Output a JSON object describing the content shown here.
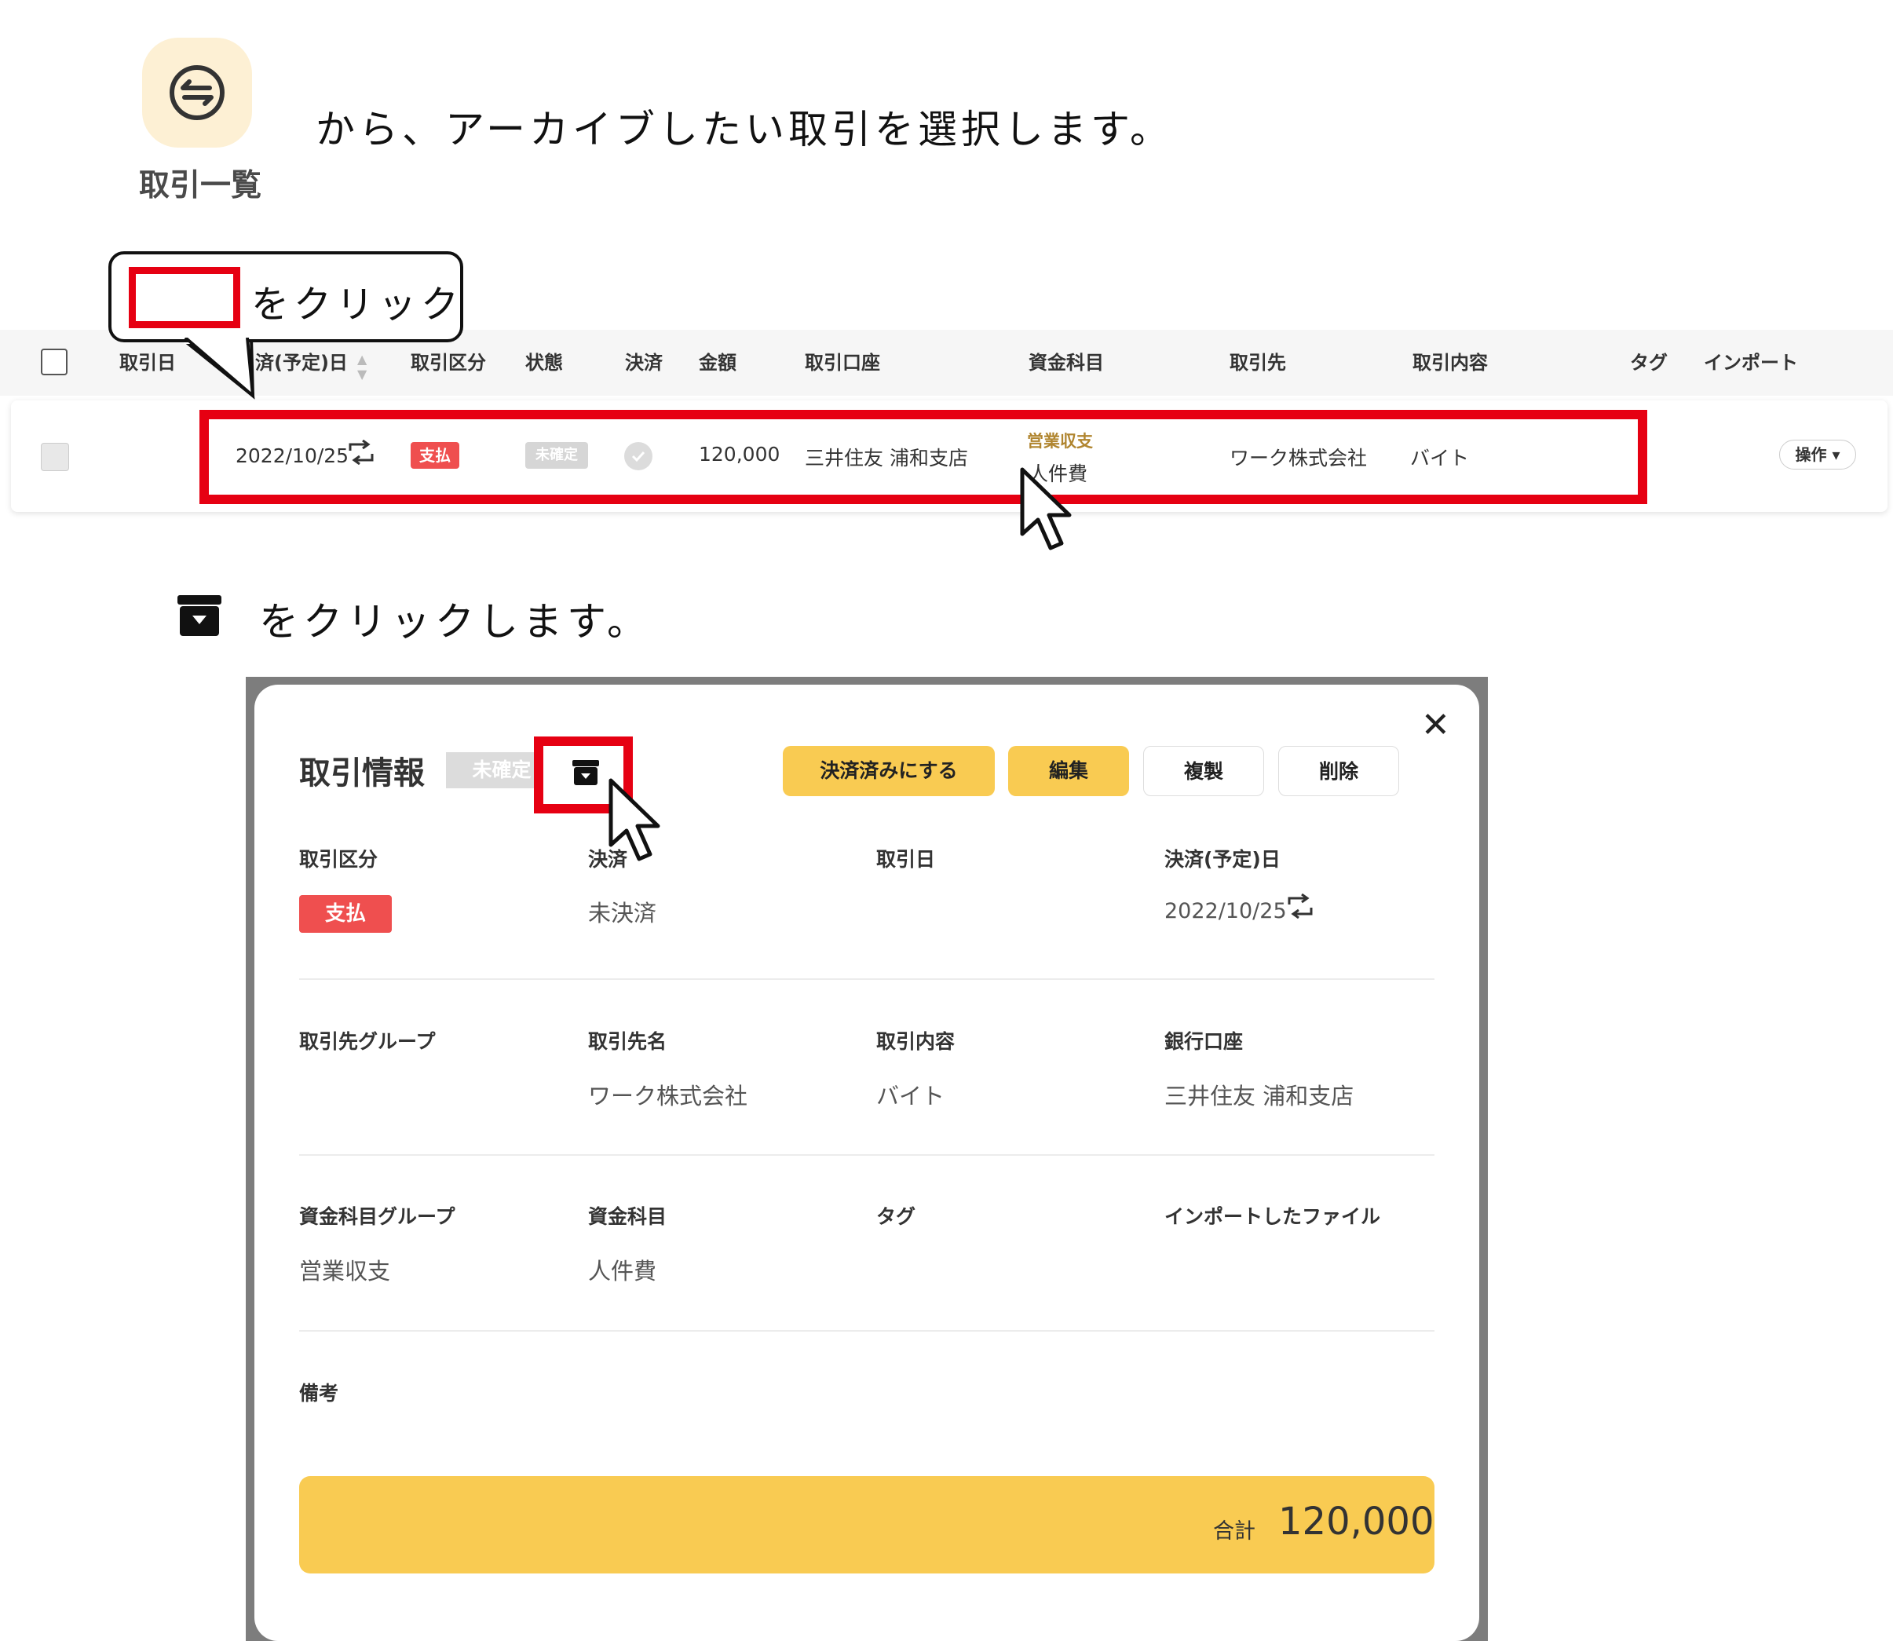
{
  "step1": {
    "nav_icon_name": "transactions-icon",
    "nav_label": "取引一覧",
    "text": "から、アーカイブしたい取引を選択します。"
  },
  "callout": {
    "text": "をクリック"
  },
  "table": {
    "headers": [
      "取引日",
      "済(予定)日",
      "取引区分",
      "状態",
      "決済",
      "金額",
      "取引口座",
      "資金科目",
      "取引先",
      "取引内容",
      "タグ",
      "インポート"
    ],
    "row": {
      "date": "2022/10/25",
      "type_badge": "支払",
      "status_badge": "未確定",
      "amount": "120,000",
      "account": "三井住友 浦和支店",
      "fund_group": "営業収支",
      "fund_item": "人件費",
      "partner": "ワーク株式会社",
      "content": "バイト",
      "ops_label": "操作 ▾"
    }
  },
  "step2": {
    "icon_name": "archive-icon",
    "text": "をクリックします。"
  },
  "modal": {
    "title": "取引情報",
    "status": "未確定",
    "buttons": {
      "settle": "決済済みにする",
      "edit": "編集",
      "duplicate": "複製",
      "delete": "削除"
    },
    "close": "✕",
    "fields": {
      "type_label": "取引区分",
      "type_value": "支払",
      "settle_label": "決済",
      "settle_value": "未決済",
      "date_label": "取引日",
      "due_label": "決済(予定)日",
      "due_value": "2022/10/25",
      "partner_group_label": "取引先グループ",
      "partner_name_label": "取引先名",
      "partner_name_value": "ワーク株式会社",
      "content_label": "取引内容",
      "content_value": "バイト",
      "bank_label": "銀行口座",
      "bank_value": "三井住友 浦和支店",
      "fund_group_label": "資金科目グループ",
      "fund_group_value": "営業収支",
      "fund_label": "資金科目",
      "fund_value": "人件費",
      "tag_label": "タグ",
      "import_label": "インポートしたファイル",
      "note_label": "備考"
    },
    "total_label": "合計",
    "total_value": "120,000"
  },
  "colors": {
    "highlight_red": "#e60012",
    "accent_yellow": "#f9cb52",
    "pay_red": "#ef4f4f",
    "fund_gold": "#b0852f"
  }
}
